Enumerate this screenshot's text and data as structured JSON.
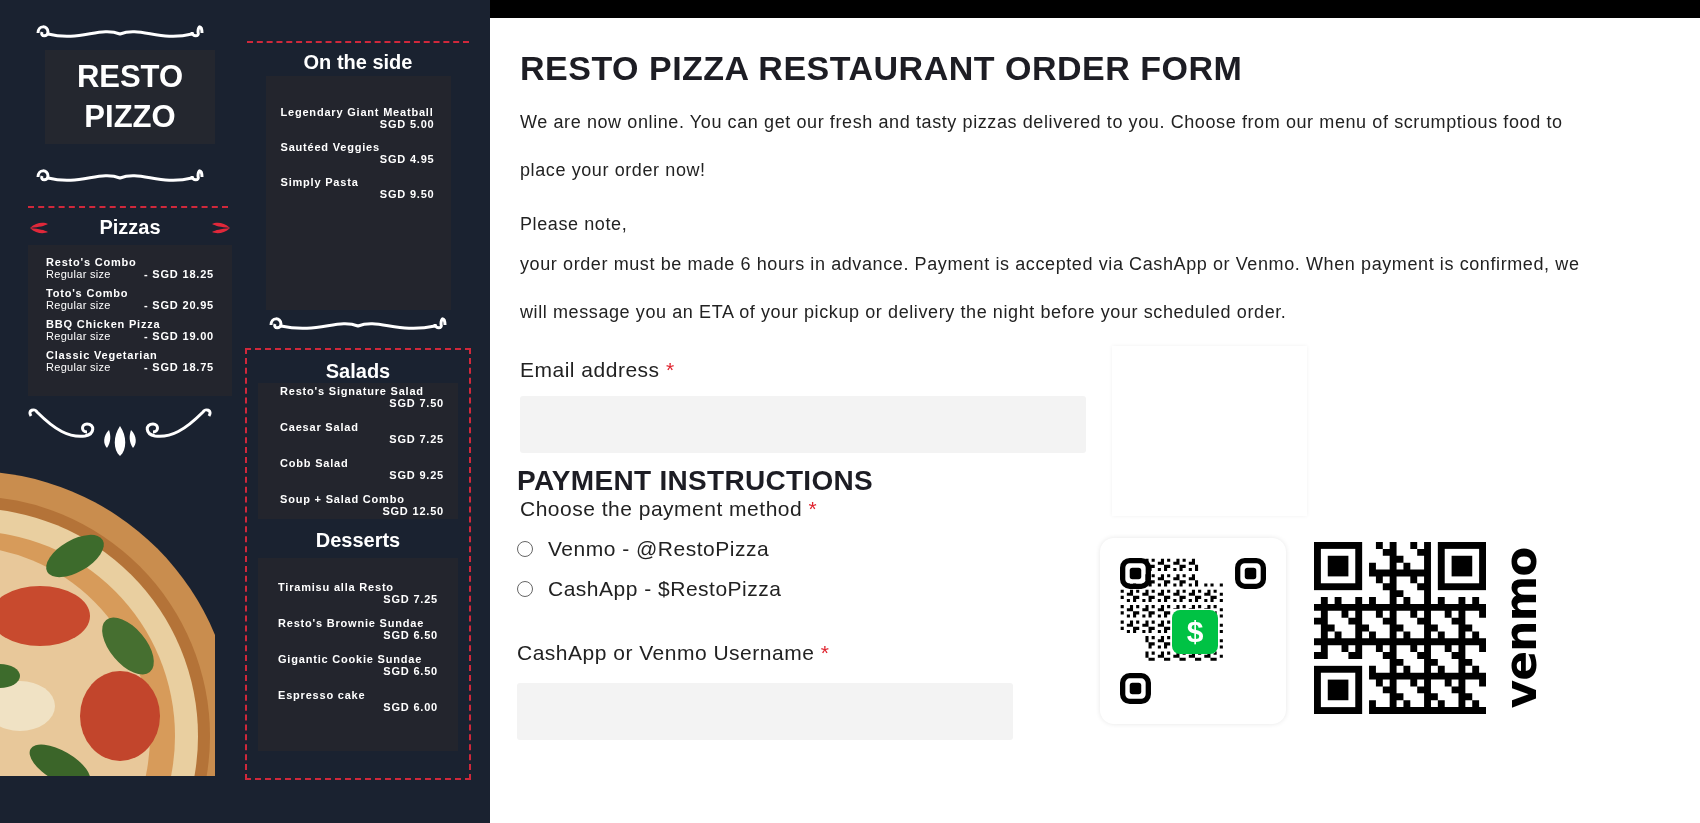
{
  "menu": {
    "title_lines": [
      "RESTO",
      "PIZZO"
    ],
    "pizzas": {
      "title": "Pizzas",
      "items": [
        {
          "name": "Resto's Combo",
          "size": "Regular size",
          "price": "- SGD 18.25"
        },
        {
          "name": "Toto's Combo",
          "size": "Regular size",
          "price": "- SGD 20.95"
        },
        {
          "name": "BBQ Chicken Pizza",
          "size": "Regular size",
          "price": "- SGD 19.00"
        },
        {
          "name": "Classic Vegetarian",
          "size": "Regular size",
          "price": "- SGD 18.75"
        }
      ]
    },
    "on_the_side": {
      "title": "On the side",
      "items": [
        {
          "name": "Legendary Giant Meatball",
          "price": "SGD 5.00"
        },
        {
          "name": "Sautéed Veggies",
          "price": "SGD 4.95"
        },
        {
          "name": "Simply Pasta",
          "price": "SGD 9.50"
        }
      ]
    },
    "salads": {
      "title": "Salads",
      "items": [
        {
          "name": "Resto's Signature Salad",
          "price": "SGD 7.50"
        },
        {
          "name": "Caesar Salad",
          "price": "SGD 7.25"
        },
        {
          "name": "Cobb Salad",
          "price": "SGD 9.25"
        },
        {
          "name": "Soup + Salad Combo",
          "price": "SGD 12.50"
        }
      ]
    },
    "desserts": {
      "title": "Desserts",
      "items": [
        {
          "name": "Tiramisu alla Resto",
          "price": "SGD 7.25"
        },
        {
          "name": "Resto's Brownie Sundae",
          "price": "SGD 6.50"
        },
        {
          "name": "Gigantic Cookie Sundae",
          "price": "SGD 6.50"
        },
        {
          "name": "Espresso cake",
          "price": "SGD 6.00"
        }
      ]
    }
  },
  "form": {
    "title": "RESTO PIZZA RESTAURANT ORDER FORM",
    "intro": "We are now online. You can get our fresh and tasty pizzas delivered to you. Choose from our menu of scrumptious food to place your order now!",
    "note_heading": "Please note,",
    "note": "your order must be made 6 hours in advance. Payment is accepted via CashApp or Venmo. When payment is confirmed, we will message you an ETA of your pickup or delivery the night before your scheduled order.",
    "email": {
      "label": "Email address",
      "required_mark": "*"
    },
    "payment_heading": "PAYMENT INSTRUCTIONS",
    "payment_method": {
      "label": "Choose the payment method",
      "required_mark": "*",
      "options": [
        {
          "label": "Venmo - @RestoPizza",
          "selected": false
        },
        {
          "label": "CashApp - $RestoPizza",
          "selected": false
        }
      ]
    },
    "username": {
      "label": "CashApp or Venmo Username",
      "required_mark": "*"
    },
    "cashapp_symbol": "$",
    "venmo_wordmark": "venmo"
  }
}
